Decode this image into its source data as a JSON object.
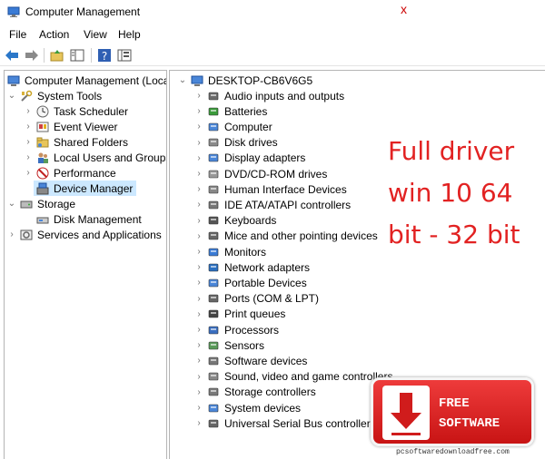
{
  "window": {
    "title": "Computer Management",
    "ghost_text": "",
    "close_glyph": "x"
  },
  "menu": {
    "file": "File",
    "action": "Action",
    "view": "View",
    "help": "Help"
  },
  "toolbar": {
    "icons": [
      "back-arrow-icon",
      "forward-arrow-icon",
      "up-folder-icon",
      "show-hide-tree-icon",
      "help-icon",
      "properties-icon"
    ]
  },
  "left_tree": {
    "root": "Computer Management (Local",
    "system_tools": "System Tools",
    "task_scheduler": "Task Scheduler",
    "event_viewer": "Event Viewer",
    "shared_folders": "Shared Folders",
    "local_users": "Local Users and Groups",
    "performance": "Performance",
    "device_manager": "Device Manager",
    "storage": "Storage",
    "disk_management": "Disk Management",
    "services": "Services and Applications"
  },
  "device_tree": {
    "computer_name": "DESKTOP-CB6V6G5",
    "categories": [
      "Audio inputs and outputs",
      "Batteries",
      "Computer",
      "Disk drives",
      "Display adapters",
      "DVD/CD-ROM drives",
      "Human Interface Devices",
      "IDE ATA/ATAPI controllers",
      "Keyboards",
      "Mice and other pointing devices",
      "Monitors",
      "Network adapters",
      "Portable Devices",
      "Ports (COM & LPT)",
      "Print queues",
      "Processors",
      "Sensors",
      "Software devices",
      "Sound, video and game controllers",
      "Storage controllers",
      "System devices",
      "Universal Serial Bus controllers"
    ]
  },
  "promo": {
    "line1": "Full driver",
    "line2": "win 10 64",
    "line3": "bit - 32 bit"
  },
  "badge": {
    "line1": "FREE",
    "line2": "SOFTWARE",
    "site": "pcsoftwaredownloadfree.com"
  },
  "colors": {
    "selection": "#cce8ff",
    "promo_text": "#e22222",
    "badge_red": "#d01c1c"
  }
}
